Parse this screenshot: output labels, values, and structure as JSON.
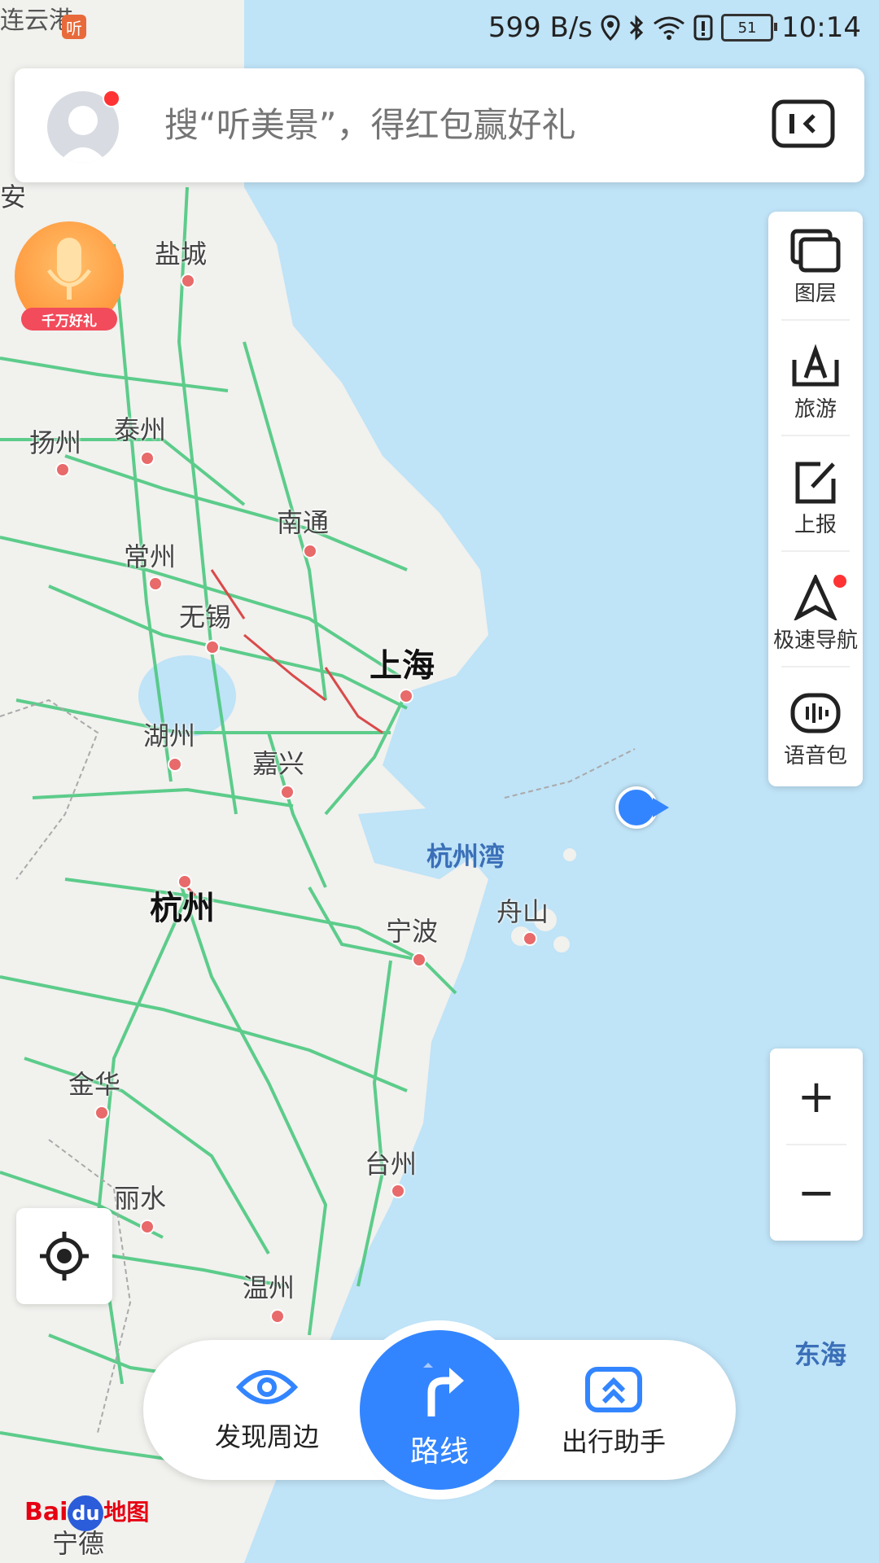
{
  "status_bar": {
    "partial_city": "连云港",
    "listen_icon": "听",
    "net_speed": "599 B/s",
    "battery": "51",
    "time": "10:14"
  },
  "search": {
    "placeholder": "搜“听美景”，得红包赢好礼"
  },
  "reward": {
    "tag": "千万好礼"
  },
  "toolbar": {
    "items": [
      {
        "label": "图层",
        "icon": "layers-icon"
      },
      {
        "label": "旅游",
        "icon": "travel-icon"
      },
      {
        "label": "上报",
        "icon": "report-icon"
      },
      {
        "label": "极速导航",
        "icon": "navigation-icon"
      },
      {
        "label": "语音包",
        "icon": "voice-pack-icon"
      }
    ]
  },
  "zoom": {
    "in": "+",
    "out": "−"
  },
  "bottom_bar": {
    "discover": "发现周边",
    "route": "路线",
    "assistant": "出行助手"
  },
  "map": {
    "cities": {
      "an": "安",
      "yancheng": "盐城",
      "yangzhou": "扬州",
      "taizhou_js": "泰州",
      "nantong": "南通",
      "changzhou": "常州",
      "wuxi": "无锡",
      "shanghai": "上海",
      "huzhou": "湖州",
      "jiaxing": "嘉兴",
      "hangzhou": "杭州",
      "ningbo": "宁波",
      "zhoushan": "舟山",
      "jinhua": "金华",
      "taizhou_zj": "台州",
      "lishui": "丽水",
      "wenzhou": "温州",
      "ningde": "宁德"
    },
    "water": {
      "hzw": "杭州湾",
      "donghai": "东海"
    }
  },
  "logo": {
    "bai": "Bai",
    "du": "du",
    "ditu": "地图"
  }
}
